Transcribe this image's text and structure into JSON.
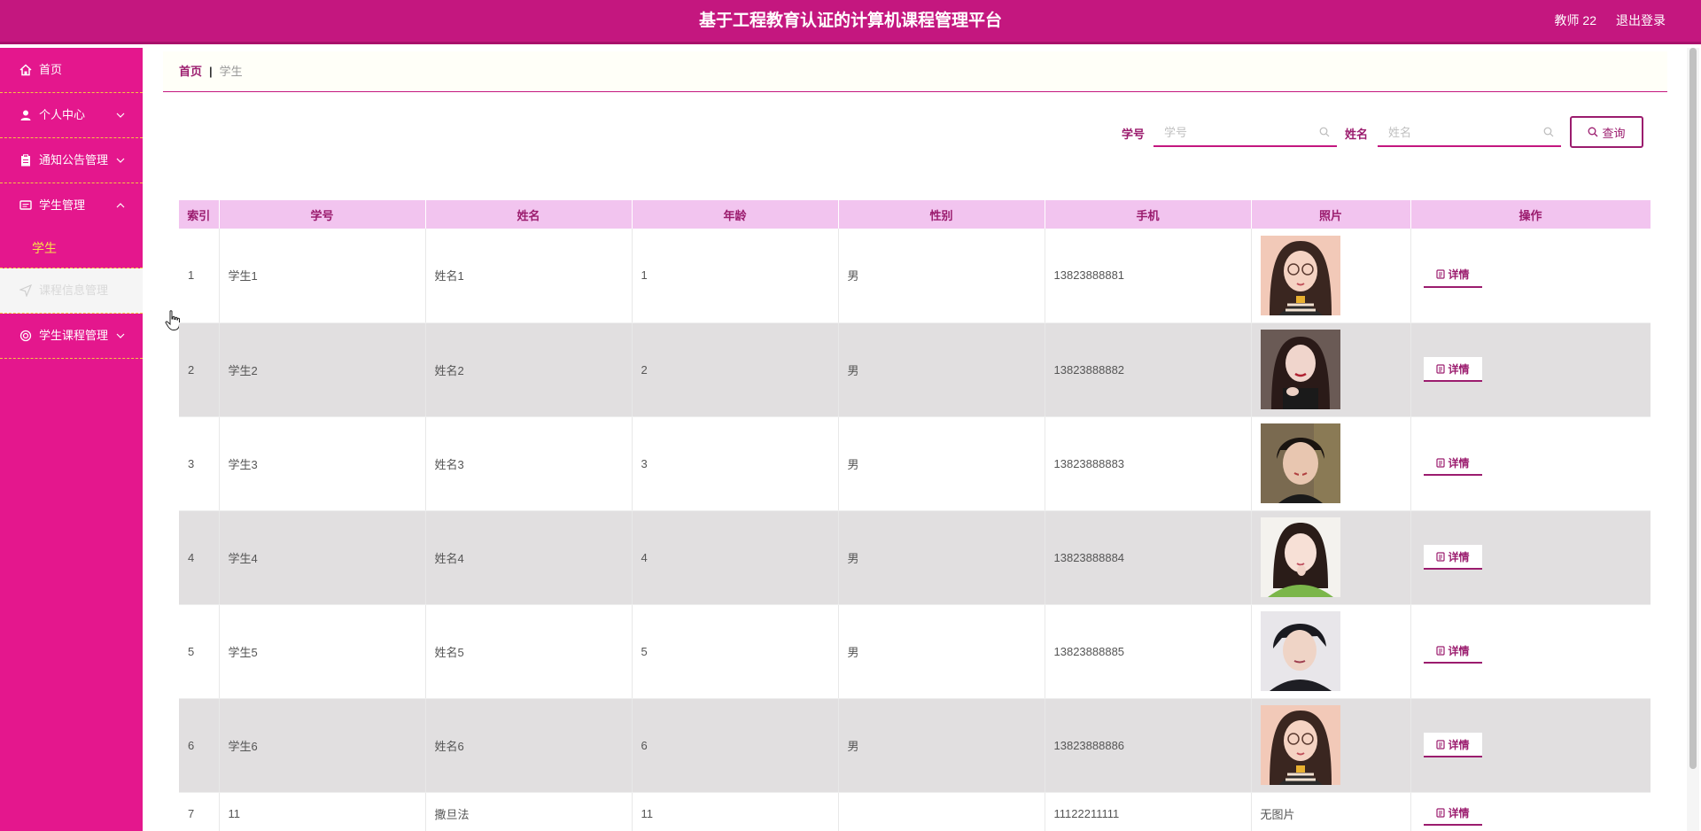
{
  "header": {
    "title": "基于工程教育认证的计算机课程管理平台",
    "user": "教师 22",
    "logout": "退出登录"
  },
  "sidebar": {
    "items": [
      {
        "label": "首页",
        "icon": "home-icon"
      },
      {
        "label": "个人中心",
        "icon": "user-icon"
      },
      {
        "label": "通知公告管理",
        "icon": "clipboard-icon"
      },
      {
        "label": "学生管理",
        "icon": "chat-icon",
        "expanded": true,
        "sub": "学生"
      },
      {
        "label": "课程信息管理",
        "icon": "send-icon",
        "disabled": true
      },
      {
        "label": "学生课程管理",
        "icon": "circle-icon"
      }
    ]
  },
  "breadcrumb": {
    "home": "首页",
    "sep": "|",
    "current": "学生"
  },
  "search": {
    "id_label": "学号",
    "id_placeholder": "学号",
    "name_label": "姓名",
    "name_placeholder": "姓名",
    "query": "查询"
  },
  "table": {
    "headers": [
      "索引",
      "学号",
      "姓名",
      "年龄",
      "性别",
      "手机",
      "照片",
      "操作"
    ],
    "detail_label": "详情",
    "no_image": "无图片",
    "rows": [
      {
        "index": "1",
        "id": "学生1",
        "name": "姓名1",
        "age": "1",
        "gender": "男",
        "phone": "13823888881",
        "photo": "photo-woman-glasses"
      },
      {
        "index": "2",
        "id": "学生2",
        "name": "姓名2",
        "age": "2",
        "gender": "男",
        "phone": "13823888882",
        "photo": "photo-woman-dark"
      },
      {
        "index": "3",
        "id": "学生3",
        "name": "姓名3",
        "age": "3",
        "gender": "男",
        "phone": "13823888883",
        "photo": "photo-man-gesture"
      },
      {
        "index": "4",
        "id": "学生4",
        "name": "姓名4",
        "age": "4",
        "gender": "男",
        "phone": "13823888884",
        "photo": "photo-woman-green"
      },
      {
        "index": "5",
        "id": "学生5",
        "name": "姓名5",
        "age": "5",
        "gender": "男",
        "phone": "13823888885",
        "photo": "photo-man-dark"
      },
      {
        "index": "6",
        "id": "学生6",
        "name": "姓名6",
        "age": "6",
        "gender": "男",
        "phone": "13823888886",
        "photo": "photo-woman-glasses"
      },
      {
        "index": "7",
        "id": "11",
        "name": "撒旦法",
        "age": "11",
        "gender": "",
        "phone": "11122211111",
        "photo": ""
      }
    ]
  },
  "colors": {
    "header": "#c4177f",
    "sidebar": "#e4178d",
    "accent": "#9b1c6e",
    "table_header": "#f2c4ef",
    "submenu_text": "#f7e04a"
  }
}
